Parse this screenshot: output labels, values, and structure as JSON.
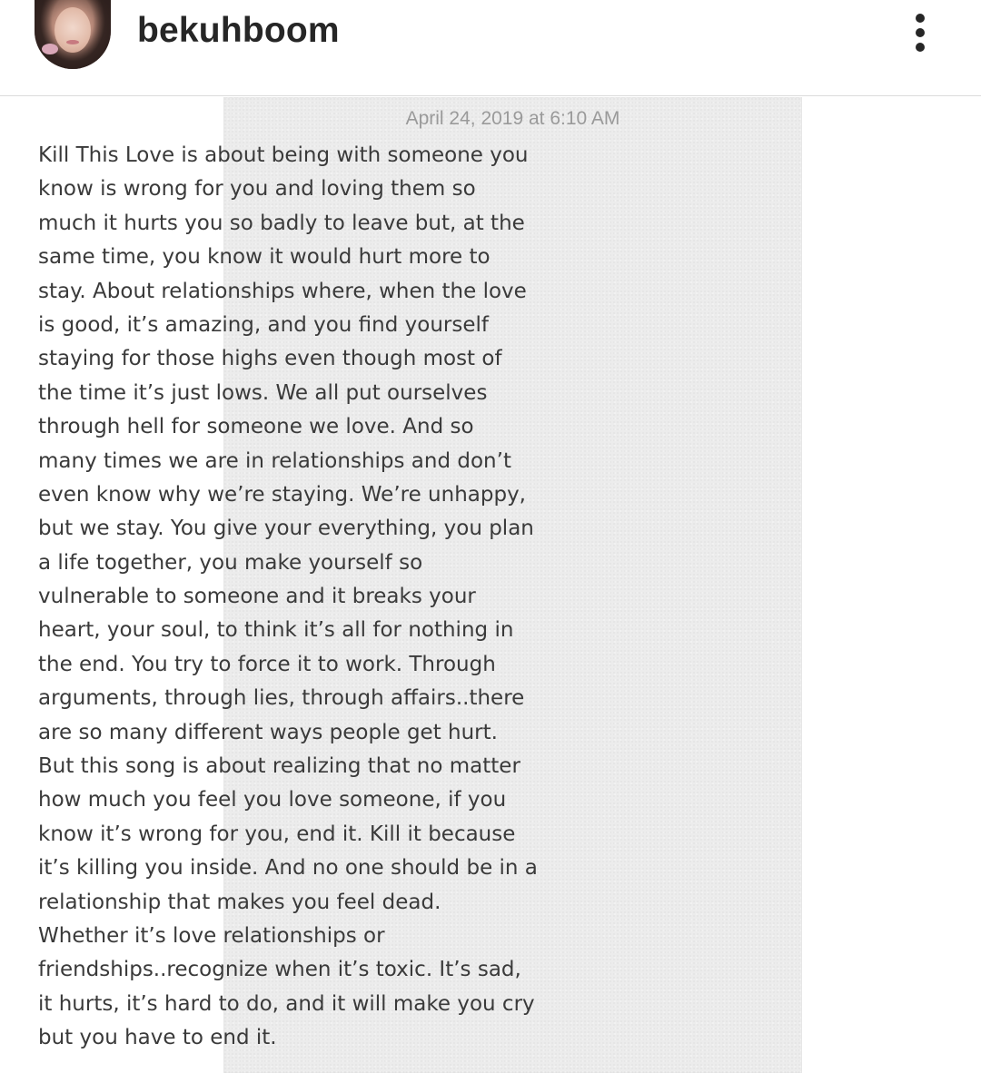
{
  "header": {
    "username": "bekuhboom",
    "avatar_icon": "profile-photo",
    "more_icon": "more-vertical-icon"
  },
  "note": {
    "date": "April 24, 2019 at 6:10 AM",
    "lines": [
      "Kill This Love is about being with someone you",
      "know is wrong for you and loving them so",
      "much it hurts you so badly to leave but, at the",
      "same time, you know it would hurt more to",
      "stay. About relationships where, when the love",
      "is good, it’s amazing, and you find yourself",
      "staying for those highs even though most of",
      "the time it’s just lows. We all put ourselves",
      "through hell for someone we love. And so",
      "many times we are in relationships and don’t",
      "even know why we’re staying. We’re unhappy,",
      "but we stay. You give your everything, you plan",
      "a life together, you make yourself so",
      "vulnerable to someone and it breaks your",
      "heart, your soul, to think it’s all for nothing in",
      "the end. You try to force it to work. Through",
      "arguments, through lies, through affairs..there",
      "are so many different ways people get hurt.",
      "But this song is about realizing that no matter",
      "how much you feel you love someone, if you",
      "know it’s wrong for you, end it. Kill it because",
      "it’s killing you inside. And no one should be in a",
      "relationship that makes you feel dead.",
      "Whether it’s love relationships or",
      "friendships..recognize when it’s toxic. It’s sad,",
      "it hurts, it’s hard to do, and it will make you cry",
      "but you have to end it."
    ]
  }
}
